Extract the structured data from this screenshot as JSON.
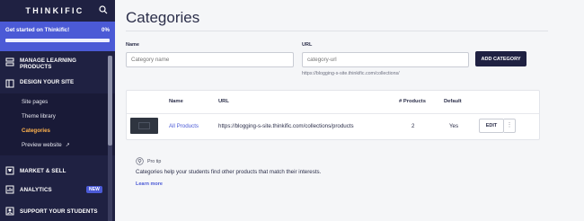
{
  "sidebar": {
    "logo": "THINKIFIC",
    "get_started": {
      "label": "Get started on Thinkific!",
      "percent_label": "0%",
      "progress": 0.0
    },
    "items": [
      {
        "label": "MANAGE LEARNING PRODUCTS",
        "icon": "stack-icon"
      },
      {
        "label": "DESIGN YOUR SITE",
        "icon": "layout-icon",
        "children": [
          {
            "label": "Site pages"
          },
          {
            "label": "Theme library"
          },
          {
            "label": "Categories",
            "active": true
          },
          {
            "label": "Preview website",
            "external_icon": "↗"
          }
        ]
      },
      {
        "label": "MARKET & SELL",
        "icon": "cart-icon"
      },
      {
        "label": "ANALYTICS",
        "icon": "chart-icon",
        "badge": "NEW"
      },
      {
        "label": "SUPPORT YOUR STUDENTS",
        "icon": "person-icon"
      }
    ]
  },
  "page": {
    "title": "Categories",
    "form": {
      "name_label": "Name",
      "name_placeholder": "Category name",
      "url_label": "URL",
      "url_placeholder": "category-url",
      "url_hint": "https://blogging-s-site.thinkific.com/collections/",
      "add_button": "ADD CATEGORY"
    },
    "table": {
      "headers": {
        "name": "Name",
        "url": "URL",
        "products": "# Products",
        "default": "Default"
      },
      "rows": [
        {
          "name": "All Products",
          "url": "https://blogging-s-site.thinkific.com/collections/products",
          "products": "2",
          "default": "Yes",
          "edit": "EDIT",
          "more": "⋮"
        }
      ]
    },
    "protip": {
      "label": "Pro tip",
      "text": "Categories help your students find other products that match their interests.",
      "link": "Learn more"
    }
  },
  "colors": {
    "sidebar_bg": "#1f2142",
    "accent": "#4b5ad6",
    "active_item": "#ffb24d"
  }
}
